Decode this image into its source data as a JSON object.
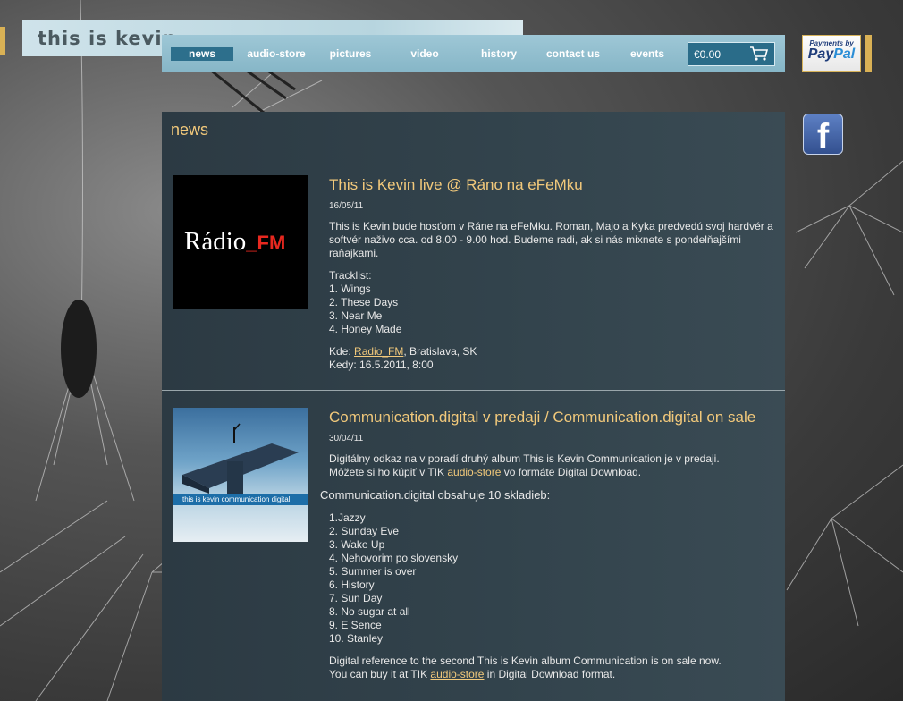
{
  "logo": "this is kevin",
  "nav": {
    "items": [
      "news",
      "audio-store",
      "pictures",
      "video",
      "history",
      "contact us",
      "events"
    ],
    "active_index": 0
  },
  "cart": {
    "total": "€0.00",
    "icon": "cart-icon"
  },
  "paypal": {
    "line1": "Payments by",
    "brand_pay": "Pay",
    "brand_pal": "Pal"
  },
  "facebook": {
    "icon": "facebook-icon",
    "glyph": "f"
  },
  "colors": {
    "accent": "#f2c97b",
    "nav_active": "#2d6f8c",
    "panel": "#33444d"
  },
  "section_title": "news",
  "posts": [
    {
      "thumb_label_main": "Rádio",
      "thumb_label_accent": "_FM",
      "title": "This is Kevin live @ Ráno na eFeMku",
      "date": "16/05/11",
      "intro": "This is Kevin bude hosťom v Ráne na eFeMku. Roman, Majo a Kyka predvedú svoj hardvér a softvér naživo cca. od 8.00 - 9.00 hod. Budeme radi, ak si nás mixnete s pondelňajšími raňajkami.",
      "tracklist_label": "Tracklist:",
      "tracks": [
        "1. Wings",
        "2. These Days",
        "3. Near Me",
        "4. Honey Made"
      ],
      "where_label": "Kde: ",
      "where_link": "Radio_FM",
      "where_rest": ", Bratislava, SK",
      "when": "Kedy: 16.5.2011, 8:00"
    },
    {
      "thumb_band": "this is kevin communication digital",
      "title": "Communication.digital v predaji / Communication.digital on sale",
      "date": "30/04/11",
      "intro_1": "Digitálny odkaz na v poradí druhý album This is Kevin Communication je v predaji.",
      "intro_2a": "Môžete si ho kúpiť v TIK ",
      "intro_2_link": "audio-store",
      "intro_2b": " vo formáte Digital Download.",
      "contains": "Communication.digital obsahuje 10 skladieb:",
      "tracks": [
        "1.Jazzy",
        "2. Sunday Eve",
        "3. Wake Up",
        "4. Nehovorim po slovensky",
        "5. Summer is over",
        "6. History",
        "7. Sun Day",
        "8. No sugar at all",
        "9. E Sence",
        "10. Stanley"
      ],
      "en_1": "Digital reference to the second This is Kevin album Communication is on sale now.",
      "en_2a": "You can buy it at TIK ",
      "en_2_link": "audio-store",
      "en_2b": " in Digital Download format."
    }
  ]
}
